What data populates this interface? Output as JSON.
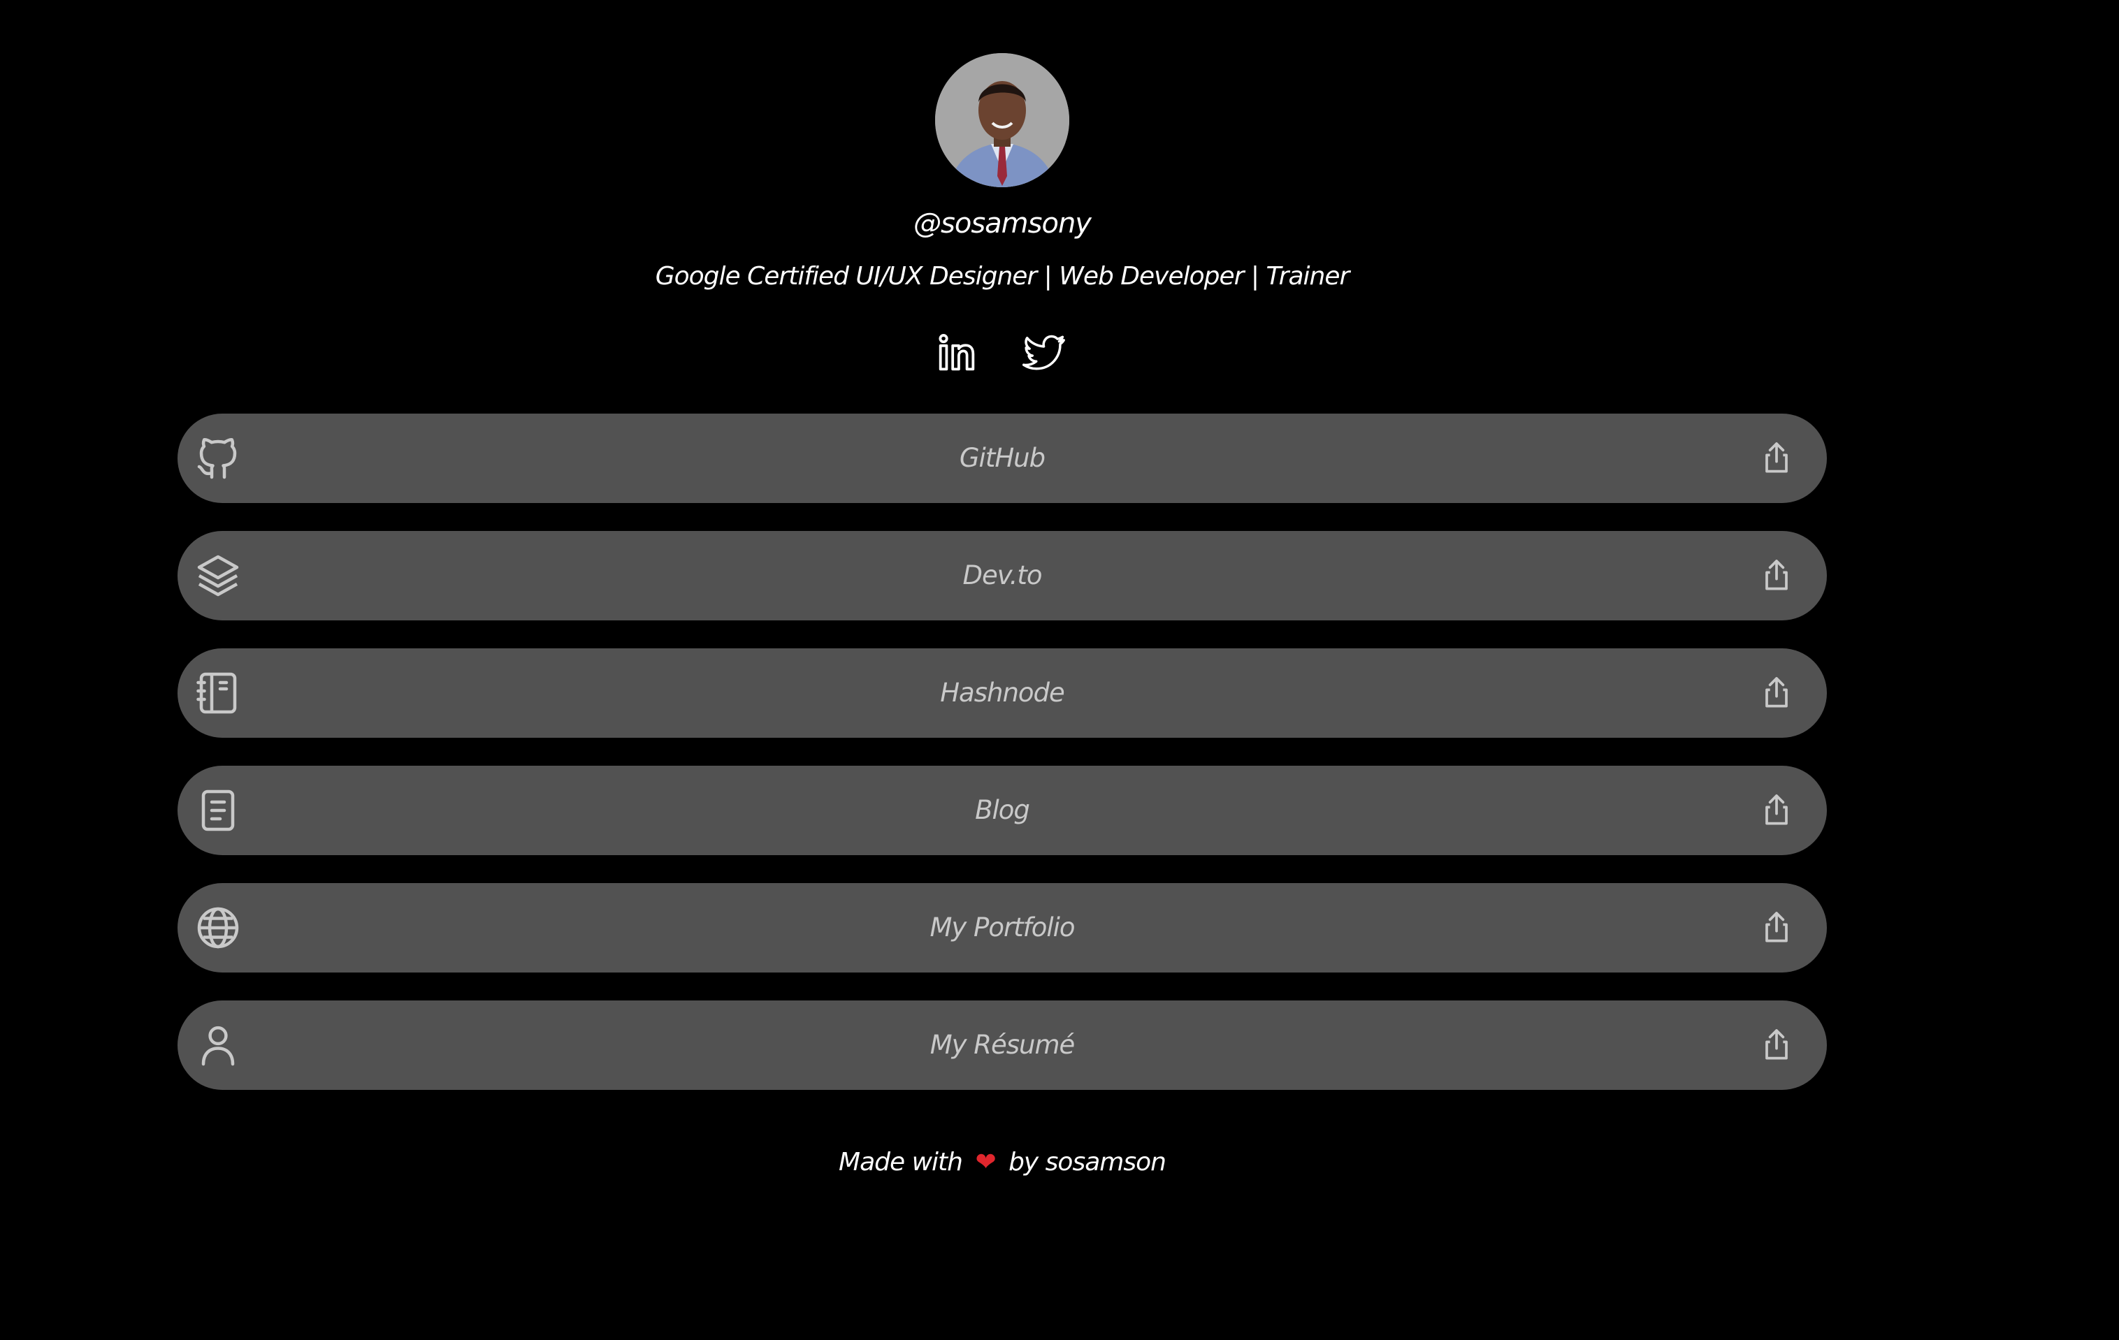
{
  "profile": {
    "avatar_alt": "Profile photo",
    "handle": "@sosamsony",
    "bio": "Google Certified UI/UX Designer | Web Developer | Trainer"
  },
  "socials": [
    {
      "name": "LinkedIn",
      "icon": "linkedin-icon"
    },
    {
      "name": "Twitter",
      "icon": "twitter-icon"
    }
  ],
  "links": [
    {
      "label": "GitHub",
      "icon": "github-icon"
    },
    {
      "label": "Dev.to",
      "icon": "layers-icon"
    },
    {
      "label": "Hashnode",
      "icon": "notebook-icon"
    },
    {
      "label": "Blog",
      "icon": "document-icon"
    },
    {
      "label": "My Portfolio",
      "icon": "globe-icon"
    },
    {
      "label": "My Résumé",
      "icon": "user-icon"
    }
  ],
  "footer": {
    "prefix": "Made with",
    "heart": "❤",
    "suffix": "by sosamson"
  },
  "colors": {
    "background": "#000000",
    "card": "#525252",
    "card_text": "#c9c9c9",
    "icon": "#c9c9c9",
    "text": "#ffffff",
    "heart": "#e0262d"
  }
}
